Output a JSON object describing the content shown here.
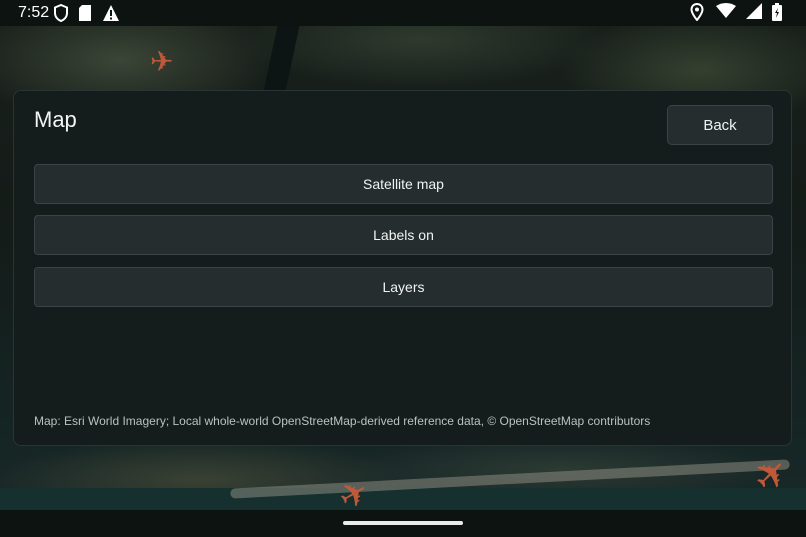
{
  "status_bar": {
    "time": "7:52",
    "left_icons": [
      "shield-icon",
      "sd-card-icon",
      "warning-icon"
    ],
    "right_icons": [
      "location-icon",
      "wifi-icon",
      "signal-icon",
      "battery-icon"
    ]
  },
  "panel": {
    "title": "Map",
    "back_label": "Back",
    "options": [
      {
        "label": "Satellite map"
      },
      {
        "label": "Labels on"
      },
      {
        "label": "Layers"
      }
    ],
    "attribution": "Map: Esri World Imagery; Local whole-world OpenStreetMap-derived reference data, © OpenStreetMap contributors"
  },
  "colors": {
    "panel_bg": "#141c1c",
    "button_bg": "#252d2f",
    "plane_marker": "#c0583a"
  }
}
